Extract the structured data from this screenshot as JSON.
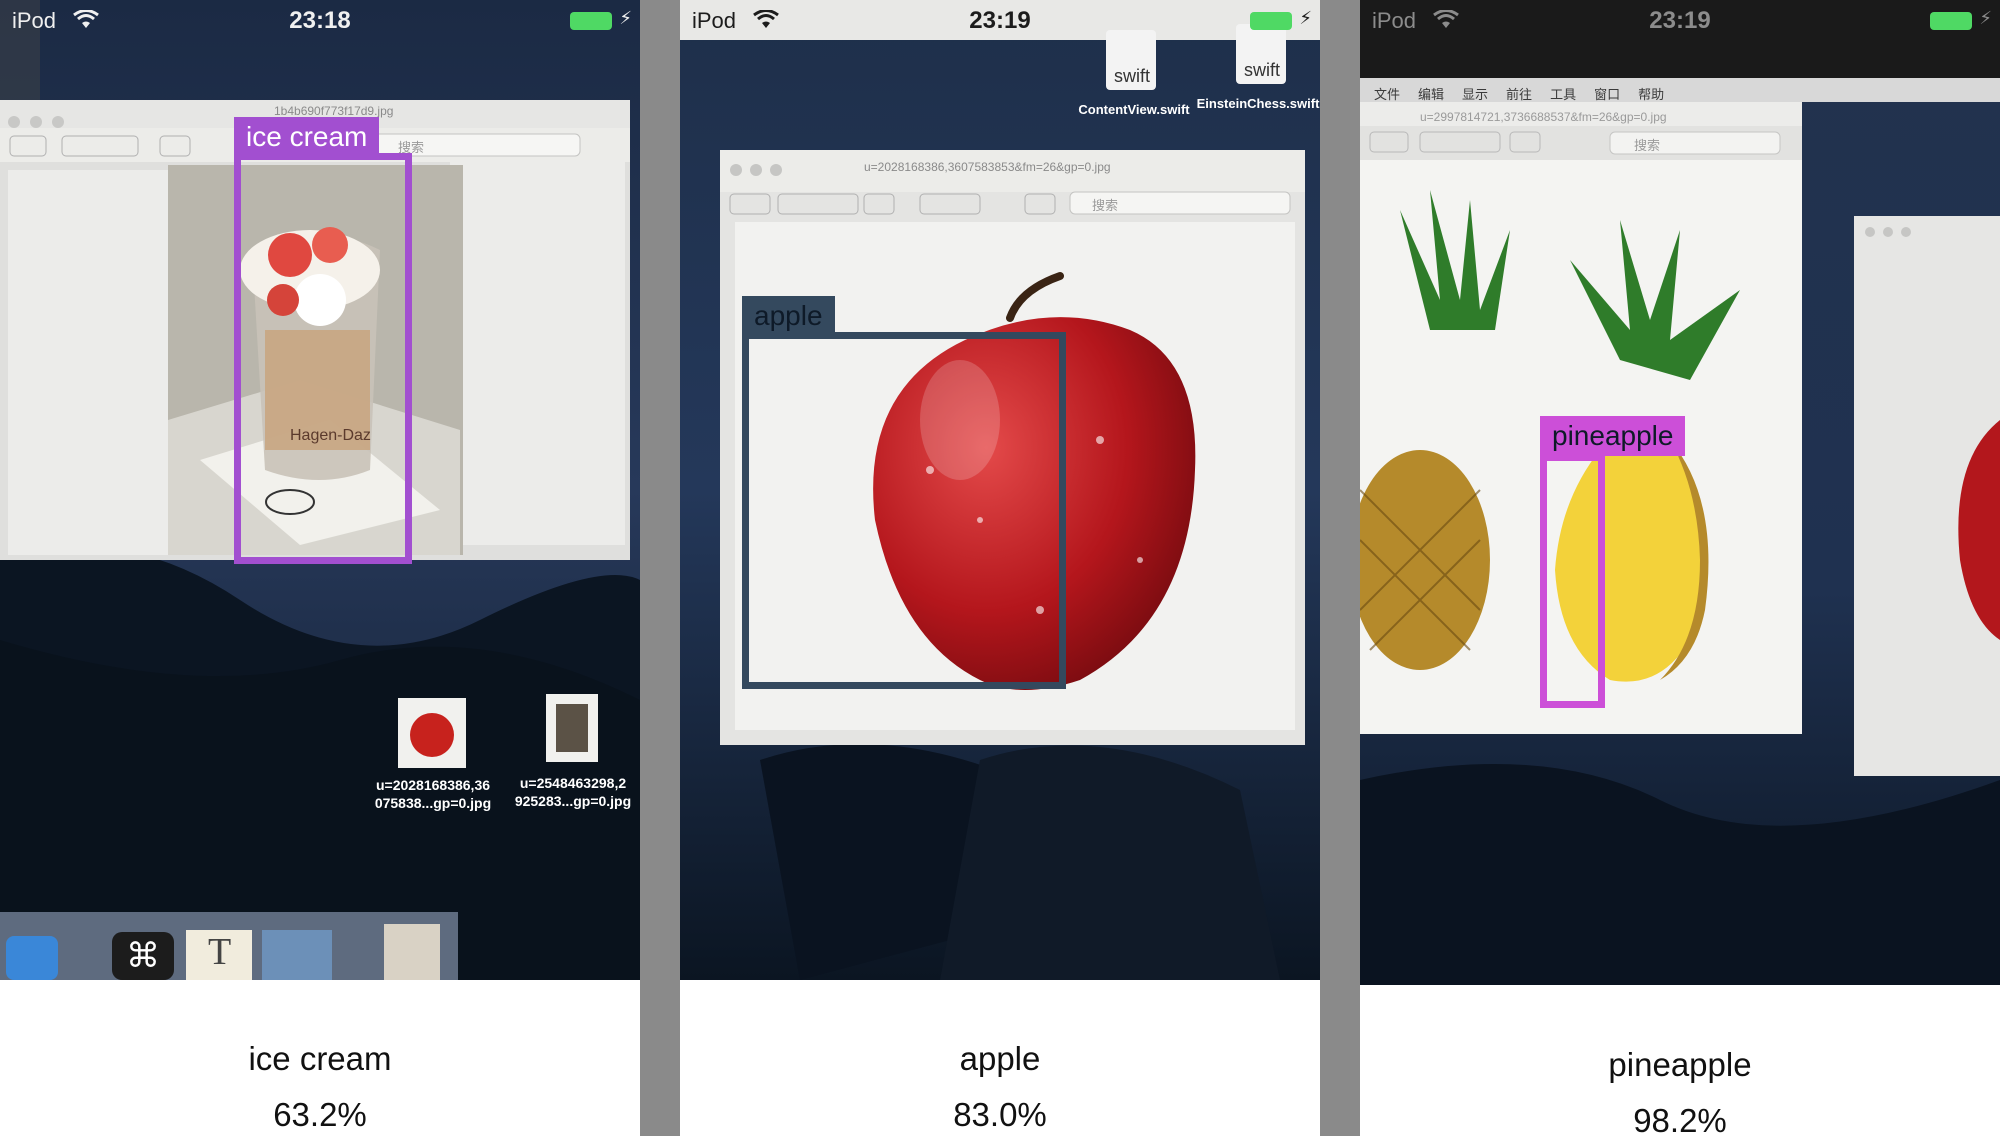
{
  "panels": [
    {
      "status": {
        "carrier": "iPod",
        "time": "23:18"
      },
      "box_color": "#a24fd0",
      "label_color": "#a24fd0",
      "label_text_color": "#ffffff",
      "detection": "ice cream",
      "result": {
        "name": "ice cream",
        "confidence": "63.2%"
      },
      "desktop": {
        "window_title": "1b4b690f773f17d9.jpg",
        "search_placeholder": "搜索",
        "files": [
          {
            "name": "u=2028168386,36 075838...gp=0.jpg"
          },
          {
            "name": "u=2548463298,2 925283...gp=0.jpg"
          }
        ],
        "dock_icons": [
          "xcode-icon",
          "acrobat-icon",
          "textedit-icon",
          "preview-icon",
          "sundae-icon"
        ]
      }
    },
    {
      "status": {
        "carrier": "iPod",
        "time": "23:19"
      },
      "box_color": "#34495e",
      "label_color": "#34495e",
      "label_text_color": "#ffffff",
      "detection": "apple",
      "result": {
        "name": "apple",
        "confidence": "83.0%"
      },
      "desktop": {
        "window_title": "u=2028168386,3607583853&fm=26&gp=0.jpg",
        "search_placeholder": "搜索",
        "files": [
          {
            "name": "ContentView.swift",
            "ext": "swift"
          },
          {
            "name": "EinsteinChess.swift",
            "ext": "swift"
          }
        ]
      }
    },
    {
      "status": {
        "carrier": "iPod",
        "time": "23:19"
      },
      "box_color": "#cc4fd8",
      "label_color": "#cc4fd8",
      "label_text_color": "#ffffff",
      "detection": "pineapple",
      "result": {
        "name": "pineapple",
        "confidence": "98.2%"
      },
      "desktop": {
        "menu_items": [
          "文件",
          "编辑",
          "显示",
          "前往",
          "工具",
          "窗口",
          "帮助"
        ],
        "window_title": "u=2997814721,3736688537&fm=26&gp=0.jpg",
        "search_placeholder": "搜索"
      }
    }
  ]
}
